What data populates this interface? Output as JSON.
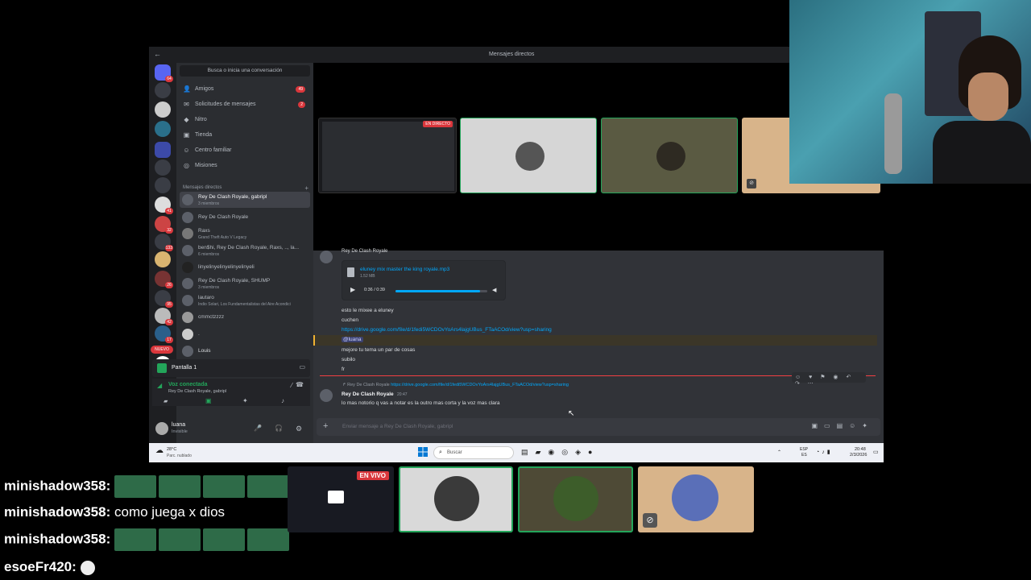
{
  "window": {
    "title": "Mensajes directos"
  },
  "sidebar": {
    "search_placeholder": "Busca o inicia una conversación",
    "nav": [
      {
        "label": "Amigos",
        "count": "49",
        "icon": "friends-icon"
      },
      {
        "label": "Solicitudes de mensajes",
        "count": "2",
        "icon": "mail-icon"
      },
      {
        "label": "Nitro",
        "count": "",
        "icon": "nitro-icon"
      },
      {
        "label": "Tienda",
        "count": "",
        "icon": "shop-icon"
      },
      {
        "label": "Centro familiar",
        "count": "",
        "icon": "family-icon"
      },
      {
        "label": "Misiones",
        "count": "",
        "icon": "quests-icon"
      }
    ],
    "dm_header": "Mensajes directos",
    "dms": [
      {
        "name": "Rey De Clash Royale, gabripl",
        "sub": "3 miembros"
      },
      {
        "name": "Rey De Clash Royale",
        "sub": ""
      },
      {
        "name": "Raxs",
        "sub": "Grand Theft Auto V Legacy"
      },
      {
        "name": "ben$hi, Rey De Clash Royale, Raxs, .., la...",
        "sub": "6 miembros"
      },
      {
        "name": "linyelinyelinyelinyelinyeli",
        "sub": ""
      },
      {
        "name": "Rey De Clash Royale, SHUMP",
        "sub": "3 miembros"
      },
      {
        "name": "lautaro",
        "sub": "Indio Solari, Los Fundamentalistas del Aire Acondici"
      },
      {
        "name": "cmmctzzzz",
        "sub": ""
      },
      {
        "name": ".",
        "sub": ""
      },
      {
        "name": "Louis",
        "sub": ""
      }
    ],
    "new_badge": "NUEVO",
    "screen_share": "Pantalla 1",
    "voice_status": "Voz conectada",
    "voice_channel": "Rey De Clash Royale, gabripl",
    "user_name": "luana",
    "user_status": "Invisible"
  },
  "stream": {
    "live_label": "EN DIRECTO"
  },
  "chat": {
    "author": "Rey De Clash Royale",
    "file_name": "eluney mix master the king royale.mp3",
    "file_size": "1.52 MB",
    "audio_time": "0:36 / 0:39",
    "audio_progress": 0.92,
    "messages": [
      "esto le mixee a eluney",
      "cuchen",
      "https://drive.google.com/file/d/1fedi5WCDOvYoArs4lajgUBus_FTaACOd/view?usp=sharing",
      "@luana",
      "mejore tu tema un par de cosas",
      "subilo",
      "fr"
    ],
    "reply_author": "Rey De Clash Royale",
    "reply_preview": "https://drive.google.com/file/d/1fedi5WCDOvYoArs4lajgUBus_FTaACOd/view?usp=sharing",
    "last_author": "Rey De Clash Royale",
    "last_time": "20:47",
    "last_message": "lo mas notorio q vas a notar es la outro mas corta y la voz mas clara",
    "input_placeholder": "Enviar mensaje a Rey De Clash Royale, gabripl"
  },
  "taskbar": {
    "weather_temp": "28°C",
    "weather_desc": "Parc. nublado",
    "search_placeholder": "Buscar",
    "lang": "ESP",
    "lang_region": "ES",
    "time": "20:48",
    "date": "2/3/2026"
  },
  "overlay": {
    "live_label": "EN VIVO",
    "chat": [
      {
        "user": "minishadow358:",
        "message": ""
      },
      {
        "user": "minishadow358:",
        "message": "como juega x dios"
      },
      {
        "user": "minishadow358:",
        "message": ""
      },
      {
        "user": "esoeFr420:",
        "message": ""
      }
    ]
  },
  "colors": {
    "accent": "#00a8fc",
    "danger": "#da373c",
    "bg_dark": "#1e1f22",
    "panel": "#2b2d31",
    "chat_bg": "#313338",
    "green": "#23a55a"
  }
}
